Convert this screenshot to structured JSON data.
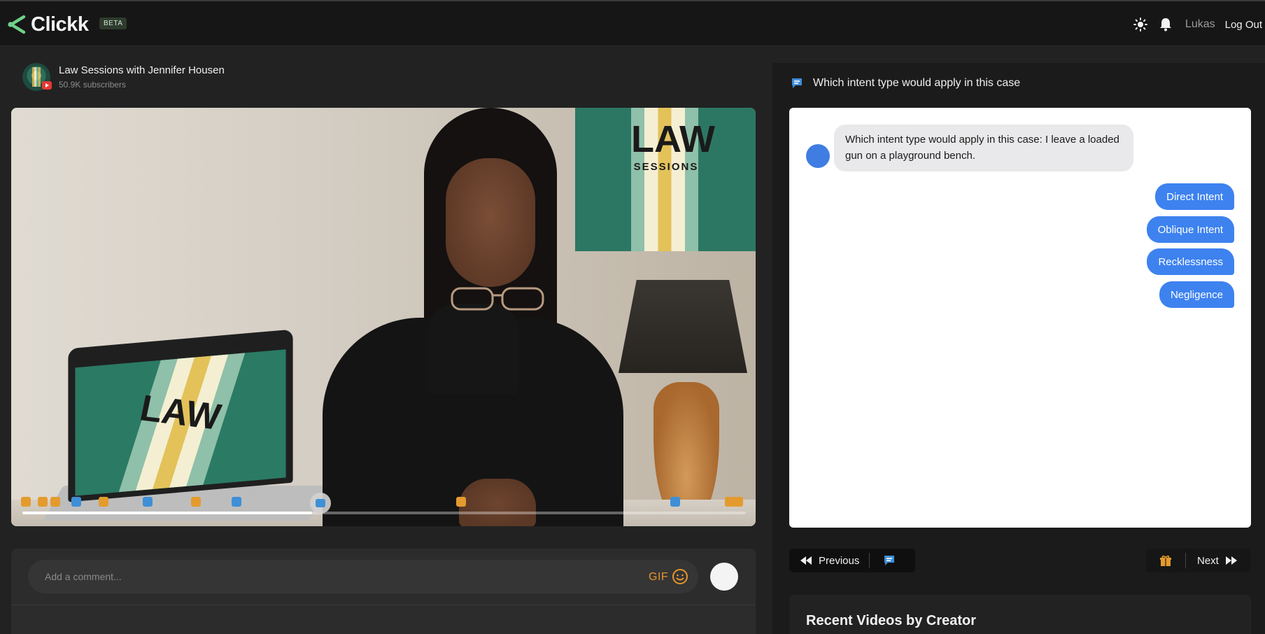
{
  "header": {
    "brand": "Clickk",
    "beta_label": "BETA",
    "user_name": "Lukas",
    "logout_label": "Log Out",
    "icons": [
      "sun-icon",
      "bell-icon"
    ]
  },
  "channel": {
    "name": "Law Sessions with Jennifer Housen",
    "subscribers": "50.9K subscribers"
  },
  "video": {
    "poster_text": "LAW",
    "poster_subtext": "SESSIONS",
    "laptop_text": "LAW",
    "progress": 0.4
  },
  "comment": {
    "placeholder": "Add a comment...",
    "gif_label": "GIF"
  },
  "quiz": {
    "header_title": "Which intent type would apply in this case",
    "question": "Which intent type would apply in this case: I leave a loaded gun on a playground bench.",
    "answers": [
      "Direct Intent",
      "Oblique Intent",
      "Recklessness",
      "Negligence"
    ],
    "previous_label": "Previous",
    "next_label": "Next"
  },
  "recent": {
    "title": "Recent Videos by Creator"
  },
  "colors": {
    "accent_blue": "#3d82ef",
    "gift_orange": "#e39b2e",
    "chat_blue": "#3f8fd6",
    "background": "#222222"
  }
}
